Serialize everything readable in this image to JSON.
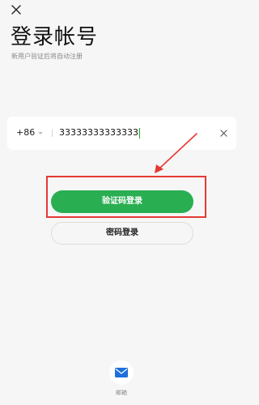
{
  "header": {
    "close_icon": "close-icon",
    "title": "登录帐号",
    "subtitle": "新用户验证后将自动注册"
  },
  "phone": {
    "country_code": "+86",
    "value": "33333333333333",
    "clear_icon": "close-icon"
  },
  "actions": {
    "sms_login_label": "验证码登录",
    "password_login_label": "密码登录"
  },
  "other_login": {
    "email_icon": "mail-icon",
    "email_label": "邮箱"
  },
  "colors": {
    "primary": "#2aae52",
    "highlight": "#e53935",
    "caret": "#1aad19"
  }
}
